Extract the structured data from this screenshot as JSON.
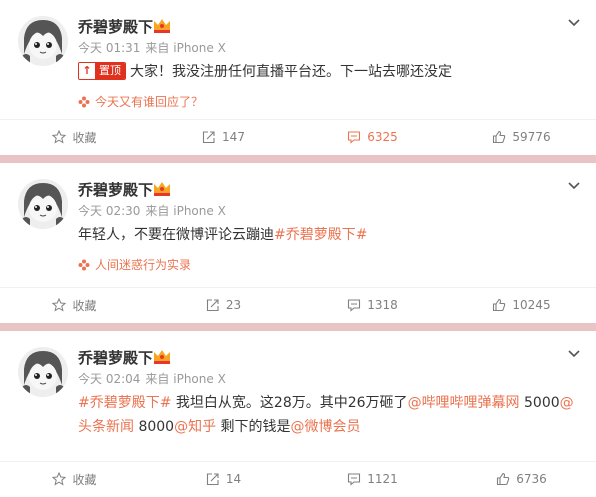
{
  "posts": [
    {
      "author": "乔碧萝殿下",
      "time": "今天 01:31",
      "source_prefix": "来自",
      "source": "iPhone X",
      "pinned_label": "置顶",
      "content_plain": "大家！我没注册任何直播平台还。下一站去哪还没定",
      "topic": "今天又有谁回应了？",
      "actions": {
        "favorite": "收藏",
        "repost": "147",
        "comment": "6325",
        "like": "59776"
      }
    },
    {
      "author": "乔碧萝殿下",
      "time": "今天 02:30",
      "source_prefix": "来自",
      "source": "iPhone X",
      "content_plain": "年轻人，不要在微博评论云蹦迪",
      "content_link": "#乔碧萝殿下#",
      "topic": "人间迷惑行为实录",
      "actions": {
        "favorite": "收藏",
        "repost": "23",
        "comment": "1318",
        "like": "10245"
      }
    },
    {
      "author": "乔碧萝殿下",
      "time": "今天 02:04",
      "source_prefix": "来自",
      "source": "iPhone X",
      "segments": [
        "#乔碧萝殿下#",
        " 我坦白从宽。这28万。其中26万砸了",
        "@哔哩哔哩弹幕网",
        " 5000",
        "@头条新闻",
        " 8000",
        "@知乎",
        " 剩下的钱是",
        "@微博会员"
      ],
      "actions": {
        "favorite": "收藏",
        "repost": "14",
        "comment": "1121",
        "like": "6736"
      }
    }
  ],
  "colors": {
    "link": "#eb7350",
    "separator": "#e9c4c4",
    "meta": "#999999",
    "action": "#808080"
  }
}
